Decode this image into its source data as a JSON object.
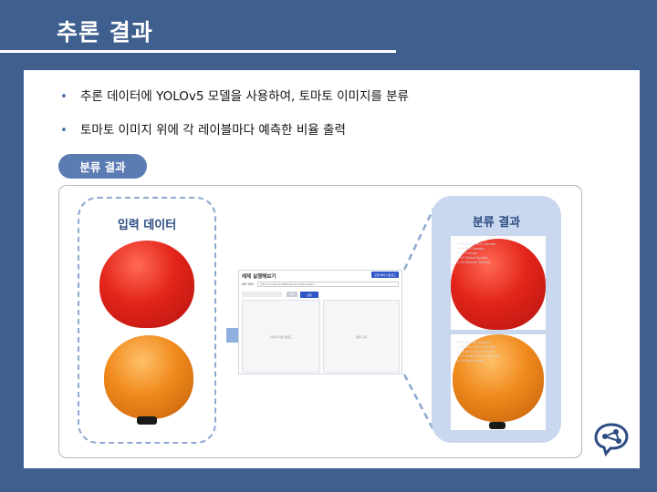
{
  "slide": {
    "title": "추론 결과"
  },
  "bullets": [
    "추론 데이터에 YOLOv5 모델을 사용하여, 토마토 이미지를 분류",
    "토마토 이미지 위에 각 레이블마다 예측한 비율 출력"
  ],
  "section_pill": "분류 결과",
  "input_box": {
    "label": "입력 데이터"
  },
  "output_box": {
    "label": "분류 결과",
    "image1_labels": [
      "0.99 Red Cherry Tomato",
      "0.00 Red Tomato",
      "0.00 Orange",
      "0.00 Yellow Tomato",
      "0.00 Maroon Tomato"
    ],
    "image2_labels": [
      "0.99 Orange Tomato",
      "0.00 Red Cherry Tomato",
      "0.00 Red Large Tomato",
      "0.00 Yellow Cherry Tomato",
      "0.00 Red Tomato"
    ]
  },
  "app": {
    "title": "예제 실행해보기",
    "header_button": "모델 예제 다운로드",
    "url_label": "API URL",
    "url_value": "http://localhost:8000/api/tomato/predict",
    "small_button": "파일",
    "run_button": "실행",
    "left_pane_text": "이미지 파일 업로드",
    "right_pane_text": "결과 출력"
  },
  "colors": {
    "background": "#3f5f8f",
    "accent": "#5b7bb3",
    "dashed_border": "#8ea8d0",
    "output_panel": "#c9d8ef",
    "primary_button": "#2f56c8"
  },
  "icons": {
    "arrow": "arrow-right-icon",
    "logo": "brain-network-icon"
  }
}
